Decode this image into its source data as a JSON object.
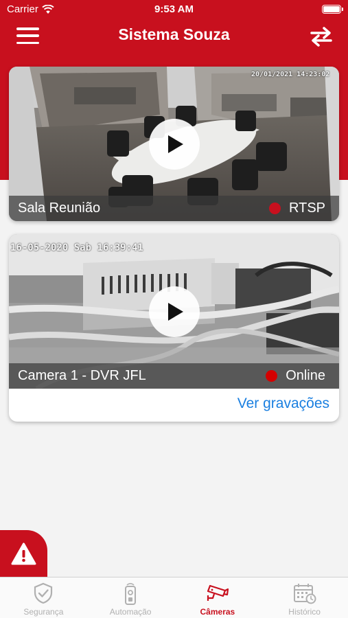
{
  "status_bar": {
    "carrier": "Carrier",
    "time": "9:53 AM"
  },
  "header": {
    "title": "Sistema Souza"
  },
  "colors": {
    "brand_red": "#c8101e",
    "link_blue": "#1a7fe0",
    "tab_inactive": "#b0b0b0"
  },
  "cameras": [
    {
      "name": "Sala Reunião",
      "status": "RTSP",
      "status_color": "#c8101e",
      "timestamp": "20/01/2021 14:23:02"
    },
    {
      "name": "Camera 1 - DVR JFL",
      "status": "Online",
      "status_color": "#d40000",
      "timestamp": "16-05-2020 Sab 16:39:41",
      "link": "Ver gravações"
    }
  ],
  "tabs": [
    {
      "label": "Segurança",
      "icon": "shield-check-icon",
      "active": false
    },
    {
      "label": "Automação",
      "icon": "remote-control-icon",
      "active": false
    },
    {
      "label": "Câmeras",
      "icon": "cctv-camera-icon",
      "active": true
    },
    {
      "label": "Histórico",
      "icon": "calendar-clock-icon",
      "active": false
    }
  ]
}
